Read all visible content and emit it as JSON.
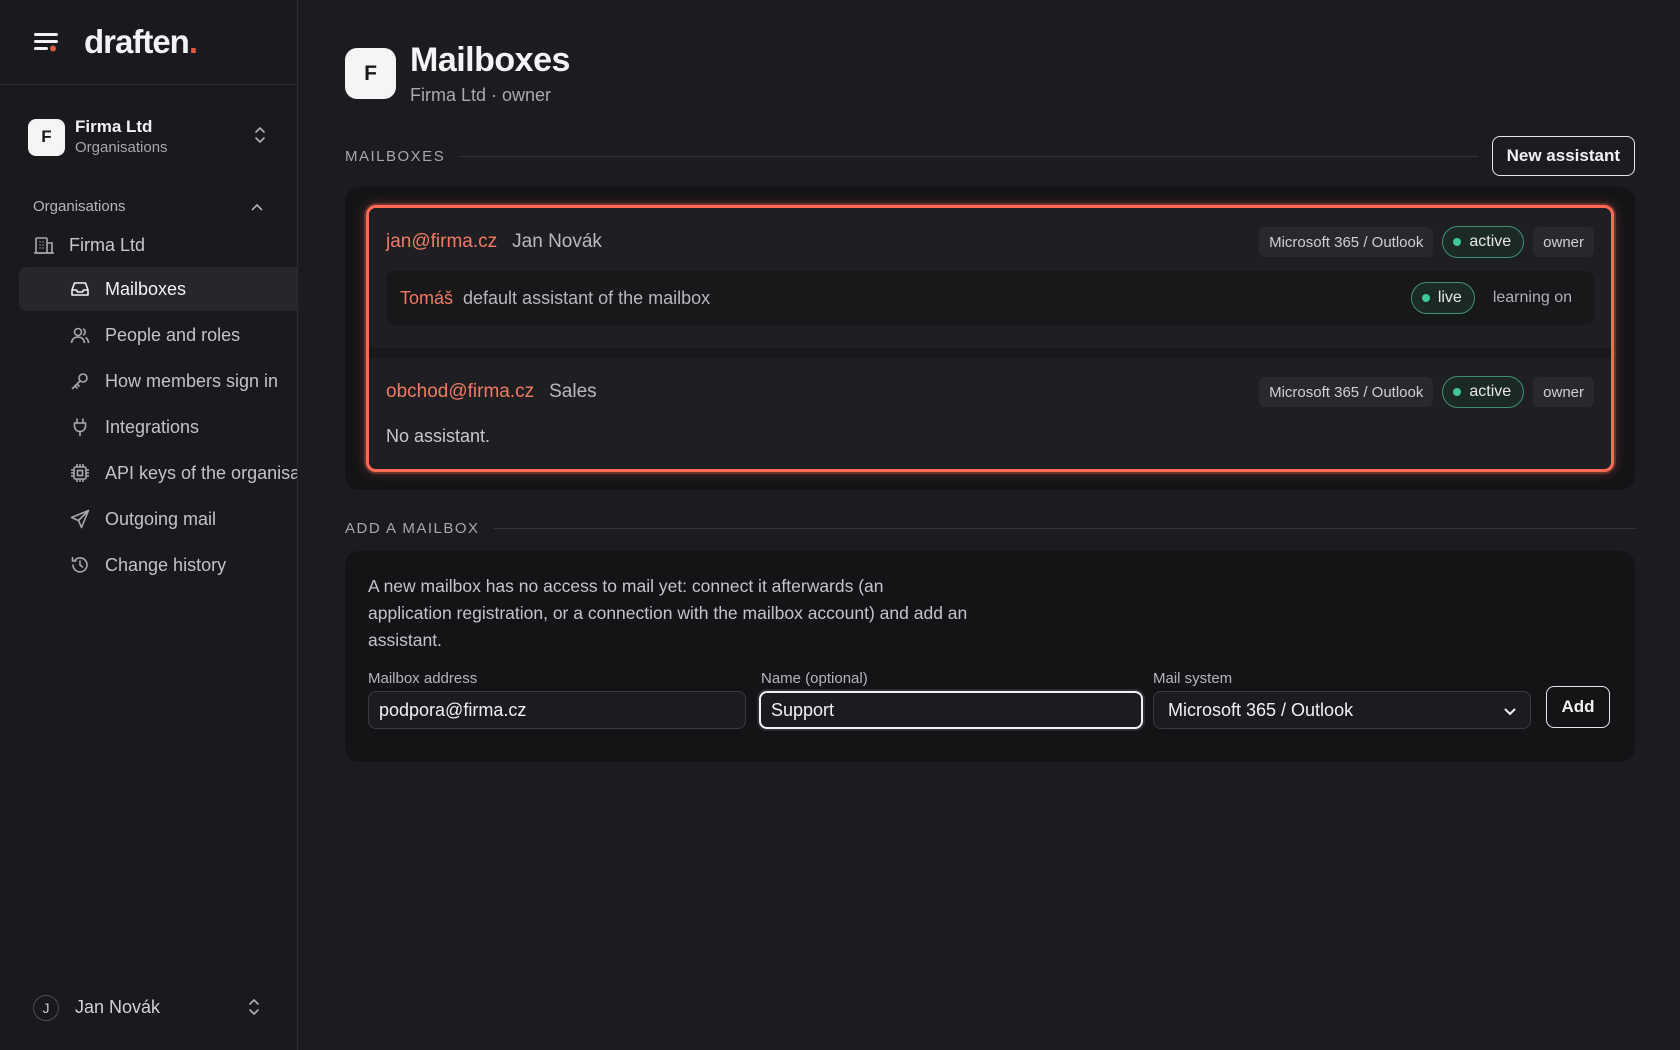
{
  "app": {
    "logo_text": "draften",
    "logo_dot": "."
  },
  "org_switcher": {
    "avatar": "F",
    "name": "Firma Ltd",
    "subtitle": "Organisations"
  },
  "sidebar": {
    "section_title": "Organisations",
    "org_item": "Firma Ltd",
    "items": [
      {
        "label": "Mailboxes",
        "icon": "inbox-icon",
        "active": true
      },
      {
        "label": "People and roles",
        "icon": "users-icon"
      },
      {
        "label": "How members sign in",
        "icon": "key-icon"
      },
      {
        "label": "Integrations",
        "icon": "plug-icon"
      },
      {
        "label": "API keys of the organisation",
        "icon": "chip-icon"
      },
      {
        "label": "Outgoing mail",
        "icon": "send-icon"
      },
      {
        "label": "Change history",
        "icon": "history-icon"
      }
    ],
    "user": {
      "avatar": "J",
      "name": "Jan Novák"
    }
  },
  "page": {
    "avatar": "F",
    "title": "Mailboxes",
    "subtitle": "Firma Ltd · owner"
  },
  "mailboxes_section": {
    "label": "MAILBOXES",
    "new_button": "New assistant",
    "items": [
      {
        "email": "jan@firma.cz",
        "name": "Jan Novák",
        "system": "Microsoft 365 / Outlook",
        "status": "active",
        "role": "owner",
        "assistant": {
          "name": "Tomáš",
          "description": "default assistant of the mailbox",
          "status": "live",
          "learning": "learning on"
        }
      },
      {
        "email": "obchod@firma.cz",
        "name": "Sales",
        "system": "Microsoft 365 / Outlook",
        "status": "active",
        "role": "owner",
        "no_assistant": "No assistant."
      }
    ]
  },
  "add_section": {
    "label": "ADD A MAILBOX",
    "description": "A new mailbox has no access to mail yet: connect it afterwards (an application registration, or a connection with the mailbox account) and add an assistant.",
    "address_label": "Mailbox address",
    "address_value": "podpora@firma.cz",
    "name_label": "Name (optional)",
    "name_value": "Support",
    "system_label": "Mail system",
    "system_value": "Microsoft 365 / Outlook",
    "add_button": "Add"
  },
  "colors": {
    "accent": "#f07a62",
    "highlight": "#ff6a55",
    "status_green": "#3fc79a",
    "background": "#1c1c20"
  }
}
